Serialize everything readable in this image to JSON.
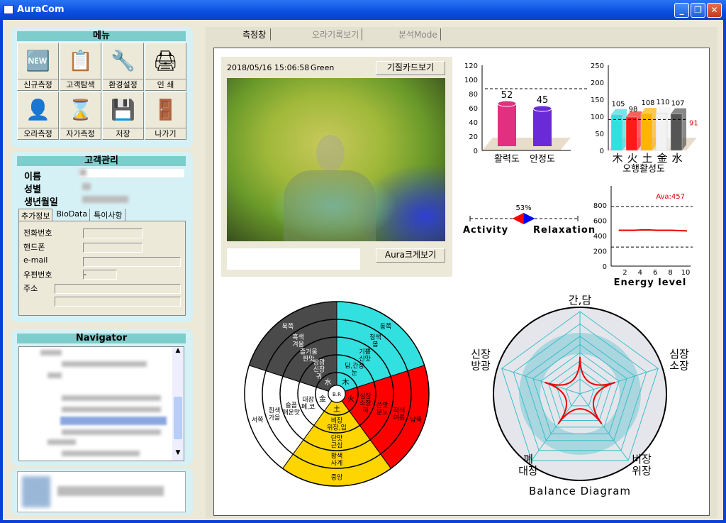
{
  "window": {
    "title": "AuraCom",
    "minimize": "_",
    "maximize": "❐",
    "close": "✕"
  },
  "menu": {
    "title": "메뉴",
    "items": [
      {
        "label": "신규측정",
        "icon": "new-measure-icon",
        "glyph": "🆕"
      },
      {
        "label": "고객탐색",
        "icon": "customer-search-icon",
        "glyph": "📋"
      },
      {
        "label": "환경설정",
        "icon": "settings-icon",
        "glyph": "🔧"
      },
      {
        "label": "인 쇄",
        "icon": "printer-icon",
        "glyph": "🖨"
      },
      {
        "label": "오라측정",
        "icon": "aura-measure-icon",
        "glyph": "👤"
      },
      {
        "label": "자가측정",
        "icon": "self-measure-icon",
        "glyph": "⌛"
      },
      {
        "label": "저장",
        "icon": "save-icon",
        "glyph": "💾"
      },
      {
        "label": "나가기",
        "icon": "exit-icon",
        "glyph": "🚪"
      }
    ]
  },
  "customer": {
    "title": "고객관리",
    "name_label": "이름",
    "gender_label": "성별",
    "birth_label": "생년월일",
    "tabs": [
      "추가정보",
      "BioData",
      "특이사항"
    ],
    "phone_label": "전화번호",
    "mobile_label": "핸드폰",
    "email_label": "e-mail",
    "zip_label": "우편번호",
    "zip_value": "-",
    "address_label": "주소"
  },
  "navigator": {
    "title": "Navigator"
  },
  "main": {
    "tabs": [
      "측정창",
      "오라기록보기",
      "분석Mode"
    ],
    "timestamp": "2018/05/16 15:06:58",
    "color": "Green",
    "card_button": "기질카드보기",
    "aura_button": "Aura크게보기"
  },
  "colors": {
    "teal": "#7ecdcd",
    "red": "#ff0000",
    "cyan": "#33e0e0",
    "yellow": "#ffd500",
    "dark": "#4a4a4a"
  },
  "chart_data": [
    {
      "type": "bar",
      "title": "",
      "categories": [
        "활력도",
        "안정도"
      ],
      "values": [
        52,
        45
      ],
      "ylim": [
        0,
        120
      ],
      "yticks": [
        0,
        20,
        40,
        60,
        80,
        100,
        120
      ],
      "reference_line": 87,
      "colors": [
        "#e0307f",
        "#6a2ad8"
      ]
    },
    {
      "type": "bar",
      "title": "오행활성도",
      "categories": [
        "木",
        "火",
        "土",
        "金",
        "水"
      ],
      "values": [
        105,
        98,
        108,
        110,
        107
      ],
      "ylim": [
        0,
        250
      ],
      "yticks": [
        0,
        50,
        100,
        150,
        200,
        250
      ],
      "reference_line": 91,
      "reference_label": "91",
      "colors": [
        "#33e0e0",
        "#ff1a1a",
        "#ffb400",
        "#f2f2f2",
        "#555555"
      ]
    },
    {
      "type": "gauge",
      "left_label": "Activity",
      "right_label": "Relaxation",
      "value_label": "53%",
      "value": 53
    },
    {
      "type": "line",
      "xlabel": "Energy level",
      "ylim": [
        0,
        900
      ],
      "yticks": [
        0,
        200,
        400,
        600,
        800
      ],
      "xticks": [
        2,
        4,
        6,
        8,
        10
      ],
      "x": [
        1,
        2,
        3,
        4,
        5,
        6,
        7,
        8,
        9,
        10
      ],
      "y": [
        470,
        470,
        470,
        475,
        475,
        470,
        470,
        470,
        465,
        462
      ],
      "ref_lines": [
        780,
        250
      ],
      "annotation": "Ava:457"
    },
    {
      "type": "wheel",
      "center": "B.R",
      "sectors": [
        {
          "element": "木",
          "color": "#33e0e0",
          "rings": [
            "담,간장\n눈",
            "기쁨\n신맛",
            "청색\n봄",
            "동쪽"
          ]
        },
        {
          "element": "火",
          "color": "#ff0000",
          "rings": [
            "심장\n소장\n혀",
            "쓴맛\n분노",
            "적색\n여름",
            "남쪽"
          ]
        },
        {
          "element": "土",
          "color": "#ffd500",
          "rings": [
            "비장\n위장,입",
            "단맛\n근심",
            "황색\n사계",
            "중앙"
          ]
        },
        {
          "element": "金",
          "color": "#ffffff",
          "rings": [
            "대장\n폐,코",
            "슬픔\n매운맛",
            "흰색\n가을",
            "서쪽"
          ]
        },
        {
          "element": "水",
          "color": "#4a4a4a",
          "rings": [
            "방광\n신장\n귀",
            "즐거움\n짠맛",
            "흑색\n겨울",
            "북쪽"
          ]
        }
      ]
    },
    {
      "type": "radar",
      "title": "Balance Diagram",
      "axes": [
        "간,담",
        "심장\n소장",
        "비장\n위장",
        "폐\n대장",
        "신장\n방광"
      ],
      "values": [
        0.45,
        0.45,
        0.45,
        0.45,
        0.45
      ]
    }
  ]
}
